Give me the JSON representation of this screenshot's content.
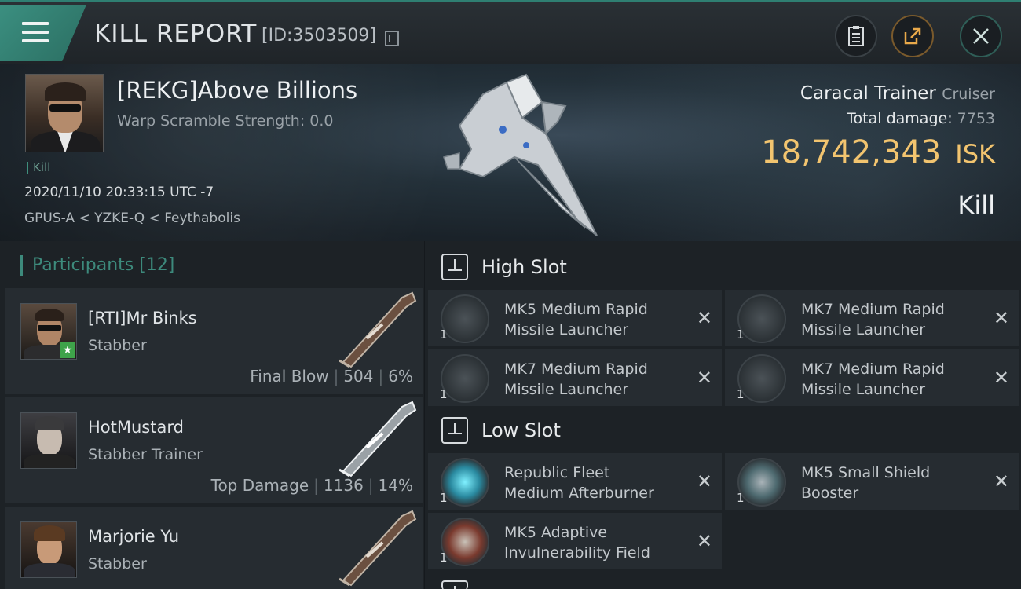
{
  "header": {
    "title": "KILL REPORT",
    "report_id": "[ID:3503509]"
  },
  "victim": {
    "name": "[REKG]Above Billions",
    "warp_scramble": "Warp Scramble Strength: 0.0",
    "tag": "Kill",
    "datetime": "2020/11/10 20:33:15 UTC -7",
    "location": "GPUS-A < YZKE-Q < Feythabolis",
    "ship_name": "Caracal Trainer",
    "ship_class": "Cruiser",
    "total_damage_label": "Total damage:",
    "total_damage_value": "7753",
    "isk_amount": "18,742,343",
    "isk_unit": "ISK",
    "result": "Kill"
  },
  "participants": {
    "heading": "Participants",
    "count": "[12]",
    "items": [
      {
        "name": "[RTI]Mr Binks",
        "ship": "Stabber",
        "role": "Final Blow",
        "damage": "504",
        "percent": "6%"
      },
      {
        "name": "HotMustard",
        "ship": "Stabber Trainer",
        "role": "Top Damage",
        "damage": "1136",
        "percent": "14%"
      },
      {
        "name": "Marjorie Yu",
        "ship": "Stabber",
        "role": "",
        "damage": "",
        "percent": ""
      }
    ]
  },
  "slots": {
    "high": {
      "title": "High Slot",
      "modules": [
        {
          "qty": "1",
          "line1": "MK5 Medium Rapid",
          "line2": "Missile Launcher"
        },
        {
          "qty": "1",
          "line1": "MK7 Medium Rapid",
          "line2": "Missile Launcher"
        },
        {
          "qty": "1",
          "line1": "MK7 Medium Rapid",
          "line2": "Missile Launcher"
        },
        {
          "qty": "1",
          "line1": "MK7 Medium Rapid",
          "line2": "Missile Launcher"
        }
      ]
    },
    "low": {
      "title": "Low Slot",
      "modules": [
        {
          "qty": "1",
          "line1": "Republic Fleet",
          "line2": "Medium Afterburner"
        },
        {
          "qty": "1",
          "line1": "MK5 Small Shield",
          "line2": "Booster"
        },
        {
          "qty": "1",
          "line1": "MK5 Adaptive",
          "line2": "Invulnerability Field"
        }
      ]
    }
  },
  "colors": {
    "accent": "#3d8a7c",
    "isk": "#f2c46f"
  }
}
